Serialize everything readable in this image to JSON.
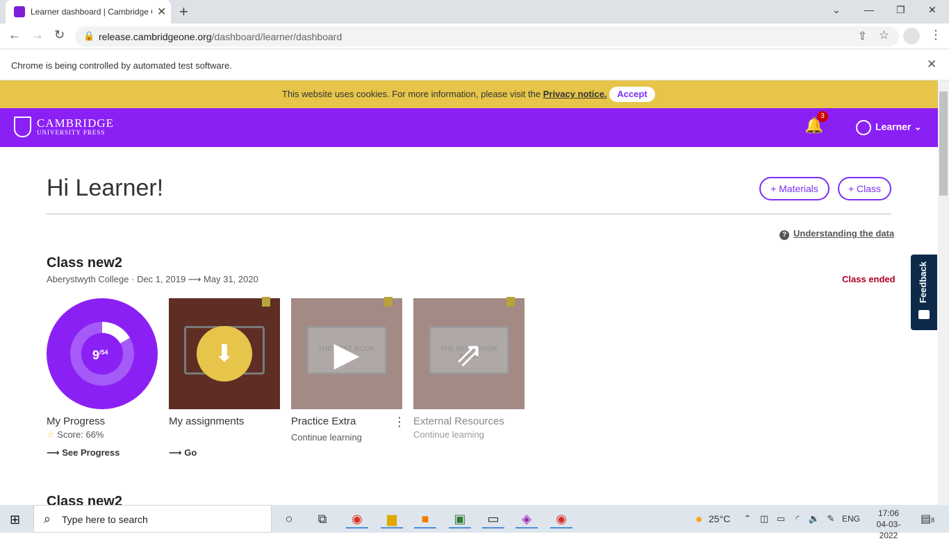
{
  "browser": {
    "tab_title": "Learner dashboard | Cambridge One",
    "new_tab": "+",
    "url_host": "release.cambridgeone.org",
    "url_path": "/dashboard/learner/dashboard",
    "infobar_message": "Chrome is being controlled by automated test software."
  },
  "cookie_banner": {
    "text": "This website uses cookies. For more information, please visit the ",
    "link": "Privacy notice.",
    "accept": "Accept"
  },
  "header": {
    "logo_line1": "CAMBRIDGE",
    "logo_line2": "UNIVERSITY PRESS",
    "notification_count": "3",
    "user_label": "Learner"
  },
  "page": {
    "greeting": "Hi Learner!",
    "materials_button": "+ Materials",
    "class_button": "+ Class",
    "understanding_link": "Understanding the data"
  },
  "class": {
    "name": "Class new2",
    "college": "Aberystwyth College",
    "dates": "· Dec 1, 2019 ⟶ May 31, 2020",
    "status": "Class ended",
    "next_class_name": "Class new2"
  },
  "cards": {
    "progress": {
      "completed": 9,
      "total": 54,
      "completed_label": "9",
      "total_label": "/54",
      "title": "My Progress",
      "score": "Score: 66%",
      "link": "⟶ See Progress"
    },
    "assignments": {
      "title": "My assignments",
      "link": "⟶ Go"
    },
    "practice": {
      "title": "Practice Extra",
      "sub": "Continue learning",
      "book_text": "THE BEST BOOK EVER"
    },
    "external": {
      "title": "External Resources",
      "sub": "Continue learning",
      "book_text": "THE BEST BOOK EVER"
    }
  },
  "feedback": {
    "label": "Feedback"
  },
  "taskbar": {
    "search_placeholder": "Type here to search",
    "temperature": "25°C",
    "language": "ENG",
    "time": "17:06",
    "date": "04-03-2022",
    "notification_count": "8"
  },
  "colors": {
    "brand_purple": "#8b20f5",
    "cookie_yellow": "#e6c54a",
    "status_red": "#b00020",
    "feedback_navy": "#0e2a4a"
  }
}
